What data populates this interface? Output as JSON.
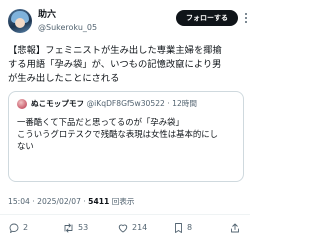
{
  "author": {
    "display_name": "助六",
    "handle": "@Sukeroku_05"
  },
  "follow_button_label": "フォローする",
  "tweet": {
    "lines": [
      "【悲報】フェミニストが生み出した専業主婦を揶揄",
      "する用語「孕み袋」が、いつもの記憶改竄により男",
      "が生み出したことにされる"
    ]
  },
  "quote": {
    "author_name": "ぬこモップモフ",
    "author_handle": "@iKqDF8Gf5w30522",
    "separator": " · ",
    "time_ago": "12時間",
    "lines": [
      "一番酷くて下品だと思ってるのが「孕み袋」",
      "こういうグロテスクで残酷な表現は女性は基本的にし",
      "ない"
    ]
  },
  "meta": {
    "time": "15:04",
    "date": "2025/02/07",
    "separator": " · ",
    "views_count": "5411",
    "views_label": " 回表示"
  },
  "actions": {
    "replies": "2",
    "reposts": "53",
    "likes": "214",
    "bookmarks": "8"
  },
  "colors": {
    "text": "#0f1419",
    "secondary": "#536471",
    "border": "#cfd9de",
    "follow_bg": "#0f1419"
  }
}
